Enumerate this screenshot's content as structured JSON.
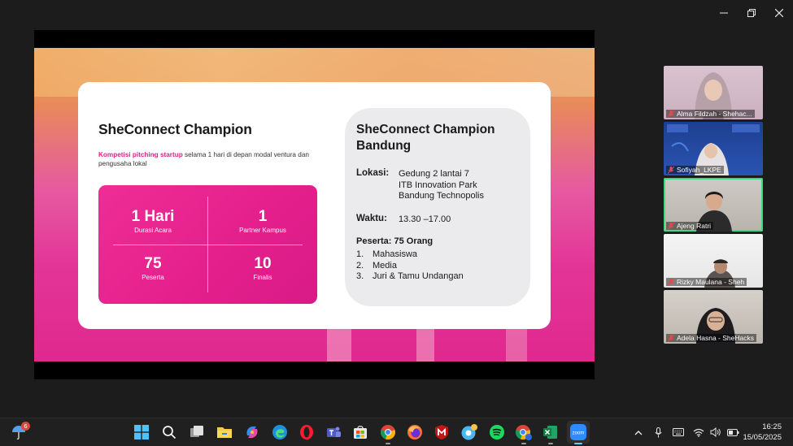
{
  "slide": {
    "title": "SheConnect Champion",
    "subtitle_highlight": "Kompetisi pitching startup",
    "subtitle_rest": " selama 1 hari di depan modal ventura dan pengusaha lokal",
    "stats": [
      {
        "value": "1 Hari",
        "label": "Durasi Acara"
      },
      {
        "value": "1",
        "label": "Partner Kampus"
      },
      {
        "value": "75",
        "label": "Peserta"
      },
      {
        "value": "10",
        "label": "Finalis"
      }
    ],
    "info": {
      "title": "SheConnect Champion Bandung",
      "lokasi_label": "Lokasi:",
      "lokasi_lines": [
        "Gedung 2 lantai 7",
        "ITB Innovation Park",
        "Bandung Technopolis"
      ],
      "waktu_label": "Waktu:",
      "waktu_value": "13.30 –17.00",
      "peserta_label": "Peserta: 75 Orang",
      "peserta_list": [
        {
          "n": "1.",
          "text": "Mahasiswa"
        },
        {
          "n": "2.",
          "text": "Media"
        },
        {
          "n": "3.",
          "text": "Juri & Tamu Undangan"
        }
      ]
    }
  },
  "participants": [
    {
      "name": "Alma Fildzah - Shehac...",
      "muted": true
    },
    {
      "name": "Sofiyah_LKPE",
      "muted": true
    },
    {
      "name": "Ajeng Ratri",
      "muted": true,
      "active": true
    },
    {
      "name": "Rizky Maulana - Sheh",
      "muted": true
    },
    {
      "name": "Adela Hasna - SheHacks",
      "muted": true
    }
  ],
  "taskbar": {
    "weather_badge": "6",
    "zoom_label": "zoom",
    "time": "16:25",
    "date": "15/05/2025"
  },
  "colors": {
    "accent_pink": "#e0218a",
    "active_speaker": "#3ddc84",
    "taskbar": "#202020"
  }
}
